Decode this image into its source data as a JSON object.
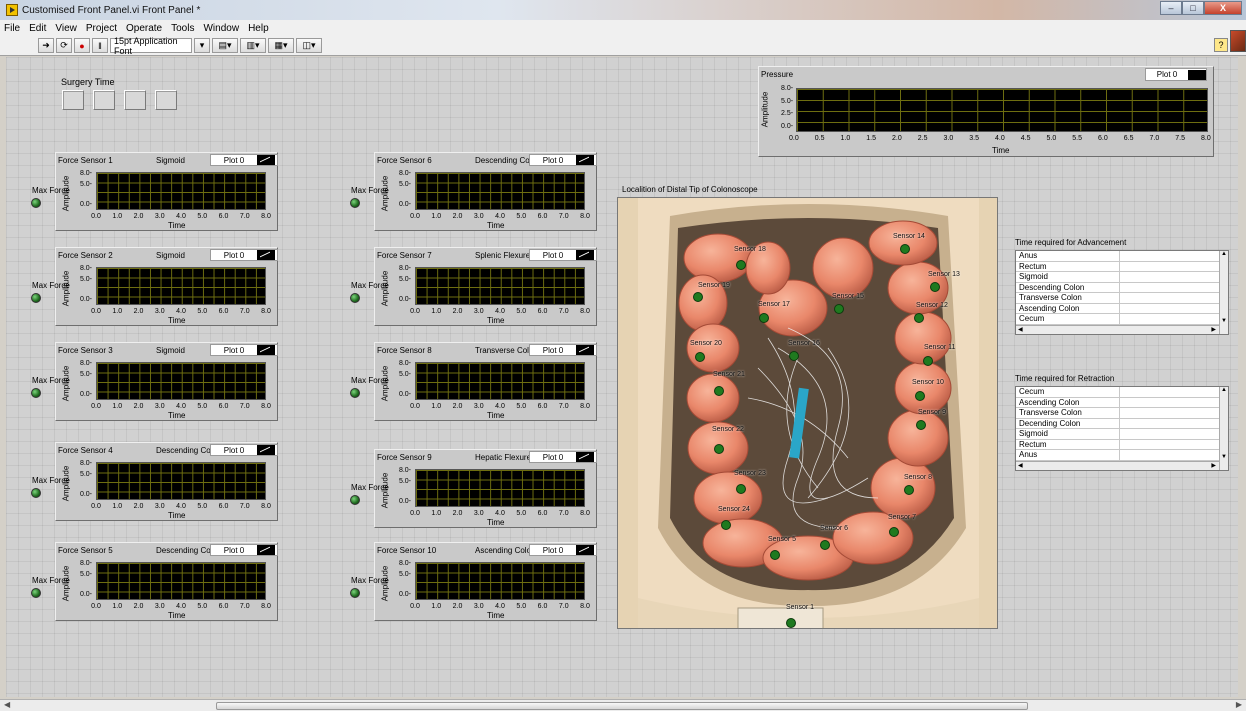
{
  "window": {
    "title": "Customised Front Panel.vi Front Panel *",
    "buttons": [
      "–",
      "□",
      "X"
    ]
  },
  "menu": [
    "File",
    "Edit",
    "View",
    "Project",
    "Operate",
    "Tools",
    "Window",
    "Help"
  ],
  "toolbar": {
    "font": "15pt Application Font",
    "help": "?"
  },
  "surgery_time": {
    "label": "Surgery Time",
    "boxes": [
      "",
      "",
      "",
      ""
    ]
  },
  "charts": [
    {
      "name": "Force Sensor 1",
      "region": "Sigmoid",
      "legend": "Plot 0",
      "led_label": "Max Force"
    },
    {
      "name": "Force Sensor 2",
      "region": "Sigmoid",
      "legend": "Plot 0",
      "led_label": "Max Force"
    },
    {
      "name": "Force Sensor 3",
      "region": "Sigmoid",
      "legend": "Plot 0",
      "led_label": "Max Force"
    },
    {
      "name": "Force Sensor 4",
      "region": "Descending Colon",
      "legend": "Plot 0",
      "led_label": "Max Force"
    },
    {
      "name": "Force Sensor 5",
      "region": "Descending Colon",
      "legend": "Plot 0",
      "led_label": "Max Force"
    },
    {
      "name": "Force Sensor 6",
      "region": "Descending Colon",
      "legend": "Plot 0",
      "led_label": "Max Force"
    },
    {
      "name": "Force Sensor 7",
      "region": "Splenic Flexure",
      "legend": "Plot 0",
      "led_label": "Max Force"
    },
    {
      "name": "Force Sensor 8",
      "region": "Transverse Colon",
      "legend": "Plot 0",
      "led_label": "Max Force"
    },
    {
      "name": "Force Sensor 9",
      "region": "Hepatic Flexure",
      "legend": "Plot 0",
      "led_label": "Max Force"
    },
    {
      "name": "Force Sensor 10",
      "region": "Ascending Colon",
      "legend": "Plot 0",
      "led_label": "Max Force"
    }
  ],
  "chart_axes": {
    "ylabel": "Amplitude",
    "xlabel": "Time",
    "yticks": [
      "8.0-",
      "5.0-",
      "0.0-"
    ],
    "xticks": [
      "0.0",
      "1.0",
      "2.0",
      "3.0",
      "4.0",
      "5.0",
      "6.0",
      "7.0",
      "8.0"
    ]
  },
  "pressure": {
    "name": "Pressure",
    "legend": "Plot 0",
    "ylabel": "Amplitude",
    "xlabel": "Time",
    "yticks": [
      "8.0-",
      "5.0-",
      "2.5-",
      "0.0-"
    ],
    "xticks": [
      "0.0",
      "0.5",
      "1.0",
      "1.5",
      "2.0",
      "2.5",
      "3.0",
      "3.5",
      "4.0",
      "4.5",
      "5.0",
      "5.5",
      "6.0",
      "6.5",
      "7.0",
      "7.5",
      "8.0"
    ]
  },
  "location": {
    "label": "Localition of  Distal Tip of Colonoscope",
    "sensor_labels": [
      "Sensor 18",
      "Sensor 14",
      "Sensor 13",
      "Sensor 19",
      "Sensor 17",
      "Sensor 15",
      "Sensor 12",
      "Sensor 20",
      "Sensor 16",
      "Sensor 11",
      "Sensor 21",
      "Sensor 10",
      "Sensor 9",
      "Sensor 22",
      "Sensor 23",
      "Sensor 8",
      "Sensor 24",
      "Sensor 6",
      "Sensor 7",
      "Sensor 5",
      "Sensor 1"
    ]
  },
  "advancement": {
    "title": "Time required for Advancement",
    "rows": [
      "Anus",
      "Rectum",
      "Sigmoid",
      "Descending Colon",
      "Transverse Colon",
      "Ascending Colon",
      "Cecum"
    ]
  },
  "retraction": {
    "title": "Time required for Retraction",
    "rows": [
      "Cecum",
      "Ascending Colon",
      "Transverse Colon",
      "Decending Colon",
      "Sigmoid",
      "Rectum",
      "Anus"
    ]
  },
  "colors": {
    "led_green": "#2e8b2e",
    "plot_bg": "#000000",
    "grid": "#6e6e10",
    "panel": "#d1d1d1"
  }
}
